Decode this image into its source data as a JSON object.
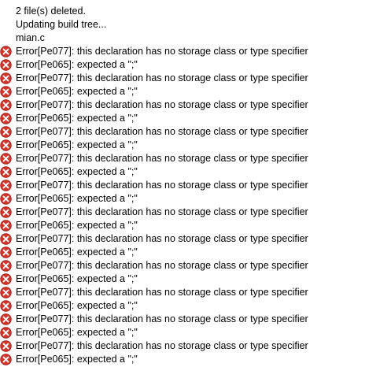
{
  "output_log": {
    "info_lines": [
      "2 file(s) deleted.",
      "Updating build tree...",
      "mian.c"
    ],
    "messages": [
      {
        "type": "error",
        "icon": "error-icon",
        "text": "Error[Pe077]: this declaration has no storage class or type specifier"
      },
      {
        "type": "error",
        "icon": "error-icon",
        "text": "Error[Pe065]: expected a \";\""
      },
      {
        "type": "error",
        "icon": "error-icon",
        "text": "Error[Pe077]: this declaration has no storage class or type specifier"
      },
      {
        "type": "error",
        "icon": "error-icon",
        "text": "Error[Pe065]: expected a \";\""
      },
      {
        "type": "error",
        "icon": "error-icon",
        "text": "Error[Pe077]: this declaration has no storage class or type specifier"
      },
      {
        "type": "error",
        "icon": "error-icon",
        "text": "Error[Pe065]: expected a \";\""
      },
      {
        "type": "error",
        "icon": "error-icon",
        "text": "Error[Pe077]: this declaration has no storage class or type specifier"
      },
      {
        "type": "error",
        "icon": "error-icon",
        "text": "Error[Pe065]: expected a \";\""
      },
      {
        "type": "error",
        "icon": "error-icon",
        "text": "Error[Pe077]: this declaration has no storage class or type specifier"
      },
      {
        "type": "error",
        "icon": "error-icon",
        "text": "Error[Pe065]: expected a \";\""
      },
      {
        "type": "error",
        "icon": "error-icon",
        "text": "Error[Pe077]: this declaration has no storage class or type specifier"
      },
      {
        "type": "error",
        "icon": "error-icon",
        "text": "Error[Pe065]: expected a \";\""
      },
      {
        "type": "error",
        "icon": "error-icon",
        "text": "Error[Pe077]: this declaration has no storage class or type specifier"
      },
      {
        "type": "error",
        "icon": "error-icon",
        "text": "Error[Pe065]: expected a \";\""
      },
      {
        "type": "error",
        "icon": "error-icon",
        "text": "Error[Pe077]: this declaration has no storage class or type specifier"
      },
      {
        "type": "error",
        "icon": "error-icon",
        "text": "Error[Pe065]: expected a \";\""
      },
      {
        "type": "error",
        "icon": "error-icon",
        "text": "Error[Pe077]: this declaration has no storage class or type specifier"
      },
      {
        "type": "error",
        "icon": "error-icon",
        "text": "Error[Pe065]: expected a \";\""
      },
      {
        "type": "error",
        "icon": "error-icon",
        "text": "Error[Pe077]: this declaration has no storage class or type specifier"
      },
      {
        "type": "error",
        "icon": "error-icon",
        "text": "Error[Pe065]: expected a \";\""
      },
      {
        "type": "error",
        "icon": "error-icon",
        "text": "Error[Pe077]: this declaration has no storage class or type specifier"
      },
      {
        "type": "error",
        "icon": "error-icon",
        "text": "Error[Pe065]: expected a \";\""
      },
      {
        "type": "error",
        "icon": "error-icon",
        "text": "Error[Pe077]: this declaration has no storage class or type specifier"
      },
      {
        "type": "error",
        "icon": "error-icon",
        "text": "Error[Pe065]: expected a \";\""
      }
    ]
  },
  "colors": {
    "background": "#ffffff",
    "text": "#000000",
    "error_icon": "#d9322b"
  }
}
